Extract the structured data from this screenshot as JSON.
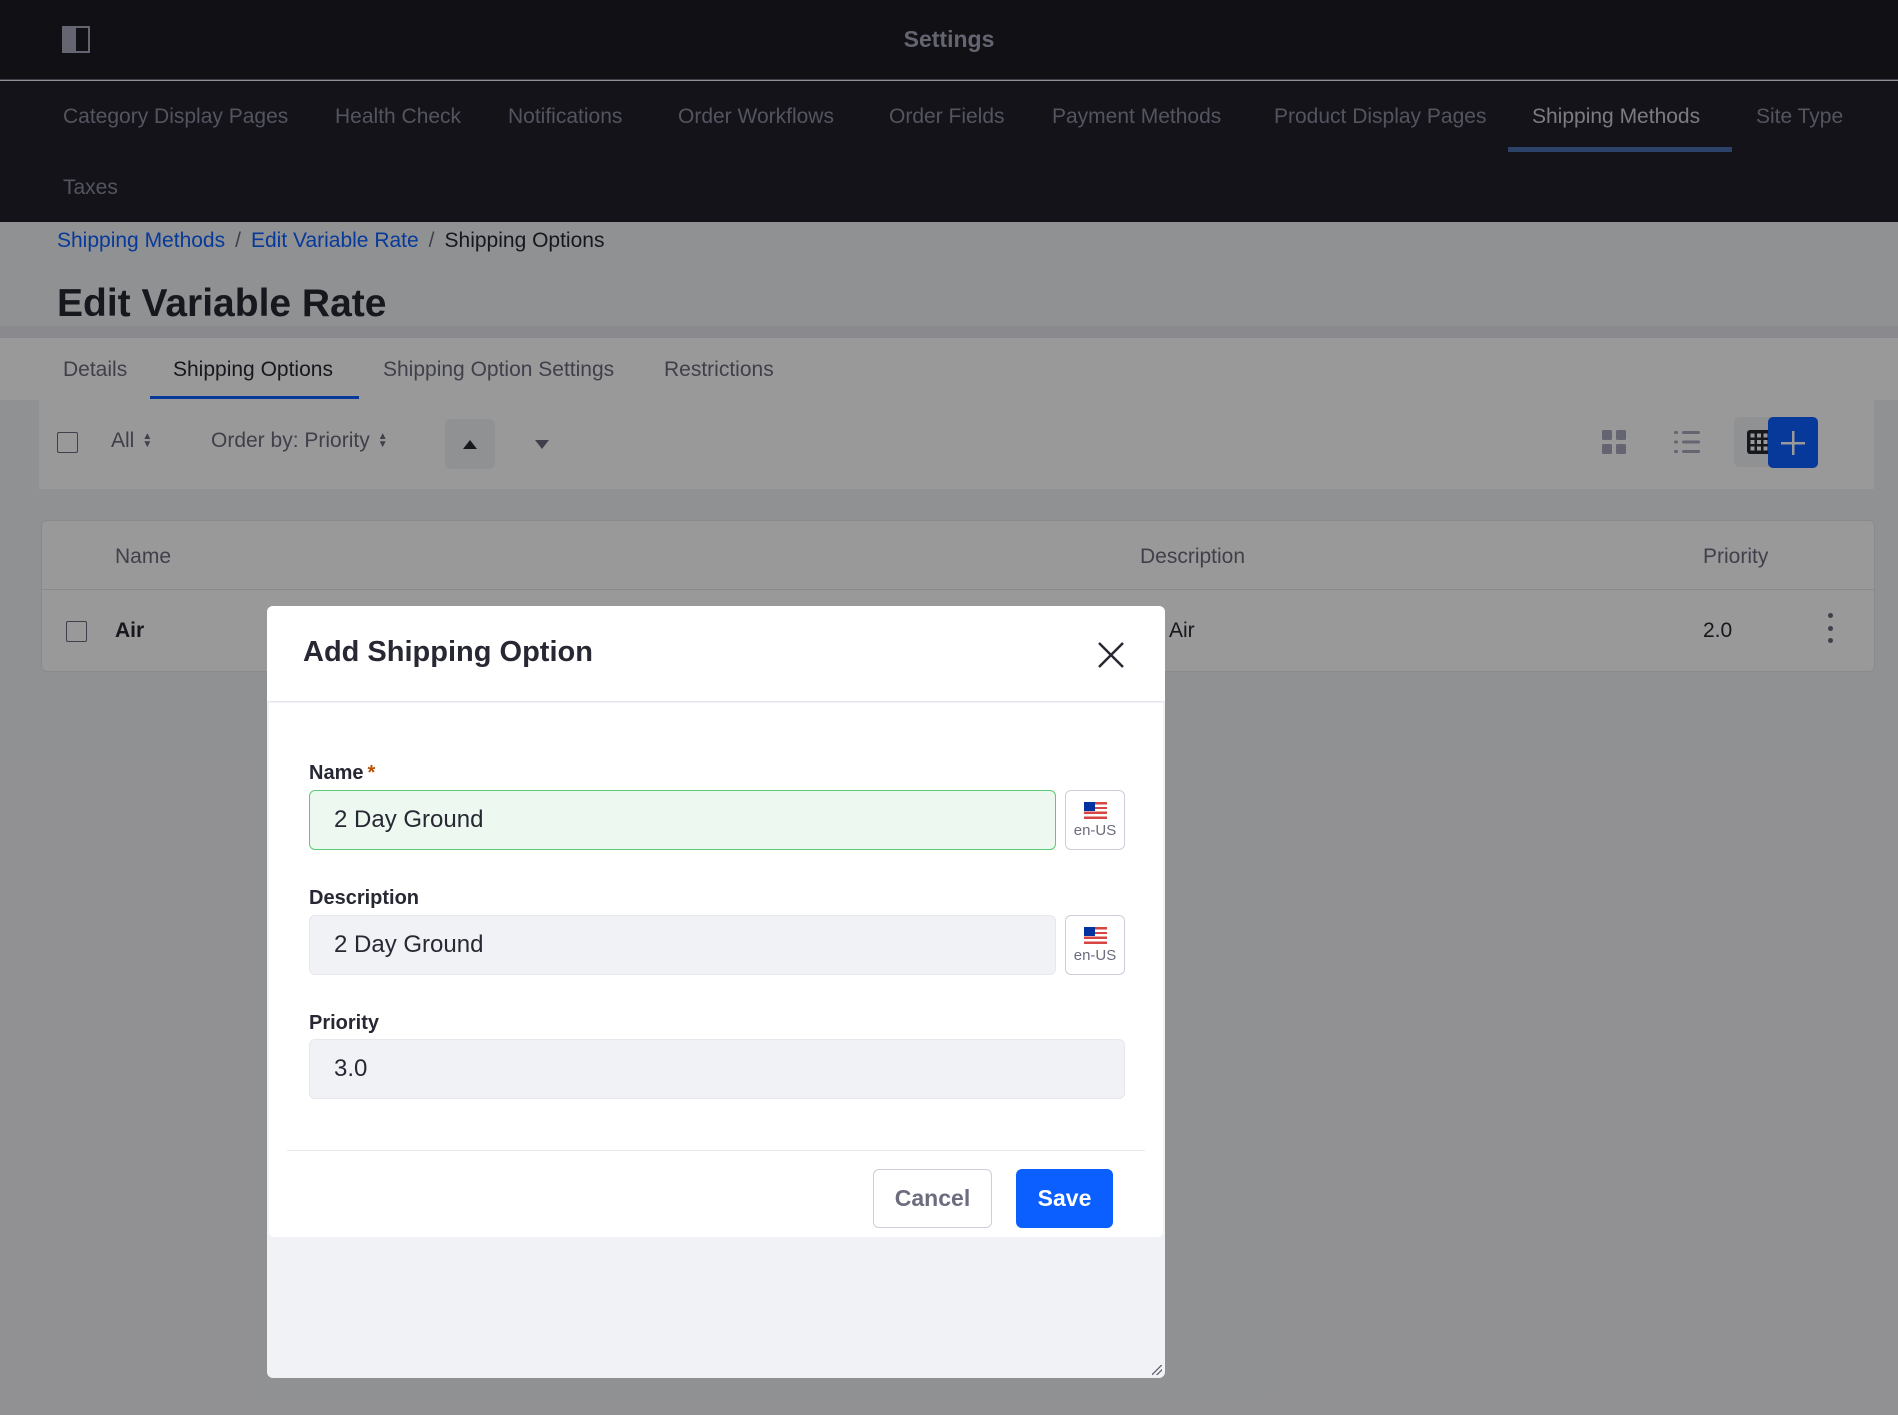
{
  "app": {
    "title": "Settings",
    "panel_toggle_icon": "sidebar-panel-icon"
  },
  "nav": {
    "items": [
      {
        "label": "Category Display Pages"
      },
      {
        "label": "Health Check"
      },
      {
        "label": "Notifications"
      },
      {
        "label": "Order Workflows"
      },
      {
        "label": "Order Fields"
      },
      {
        "label": "Payment Methods"
      },
      {
        "label": "Product Display Pages"
      },
      {
        "label": "Shipping Methods",
        "active": true
      },
      {
        "label": "Site Type"
      },
      {
        "label": "Taxes"
      }
    ]
  },
  "breadcrumb": {
    "items": [
      "Shipping Methods",
      "Edit Variable Rate",
      "Shipping Options"
    ],
    "separator": "/"
  },
  "page": {
    "title": "Edit Variable Rate",
    "tabs": [
      {
        "label": "Details"
      },
      {
        "label": "Shipping Options",
        "active": true
      },
      {
        "label": "Shipping Option Settings"
      },
      {
        "label": "Restrictions"
      }
    ]
  },
  "toolbar": {
    "filter_label": "All",
    "order_by_label": "Order by: Priority",
    "sort_ascending_icon": "caret-up-icon",
    "sort_descending_icon": "caret-down-icon",
    "views": [
      "cards-view-icon",
      "list-view-icon",
      "table-view-icon"
    ],
    "active_view": "table",
    "add_icon": "plus-icon"
  },
  "table": {
    "columns": [
      "Name",
      "Description",
      "Priority"
    ],
    "rows": [
      {
        "name": "Air",
        "description": "Air",
        "priority": "2.0"
      }
    ]
  },
  "modal": {
    "title": "Add Shipping Option",
    "close_icon": "close-icon",
    "fields": {
      "name": {
        "label": "Name",
        "required_mark": "*",
        "value": "2 Day Ground",
        "locale": "en-US"
      },
      "description": {
        "label": "Description",
        "value": "2 Day Ground",
        "locale": "en-US"
      },
      "priority": {
        "label": "Priority",
        "value": "3.0"
      }
    },
    "cancel_label": "Cancel",
    "save_label": "Save"
  },
  "colors": {
    "primary": "#0b5fff",
    "header_bg": "#1c1c24",
    "nav_bg": "#20212b",
    "valid_border": "#5aca75",
    "required": "#b95000"
  }
}
